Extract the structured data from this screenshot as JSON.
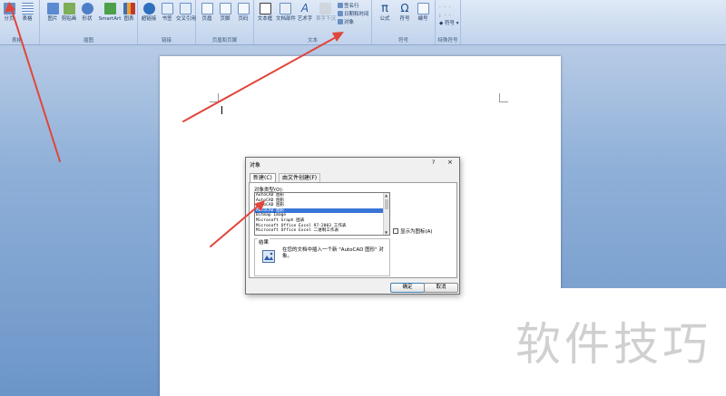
{
  "ribbon": {
    "groups": {
      "table": "表格",
      "illustrations": "插图",
      "links": "链接",
      "header_footer": "页眉和页脚",
      "text": "文本",
      "symbols": "符号",
      "special": "特殊符号"
    },
    "buttons": {
      "page_break": "分页",
      "table": "表格",
      "picture": "图片",
      "clip_art": "剪贴画",
      "shapes": "形状",
      "smartart": "SmartArt",
      "chart": "图表",
      "hyperlink": "超链接",
      "bookmark": "书签",
      "cross_ref": "交叉引用",
      "header": "页眉",
      "footer": "页脚",
      "page_number": "页码",
      "text_box": "文本框",
      "quick_parts": "文档部件",
      "wordart": "艺术字",
      "drop_cap": "首字下沉",
      "signature_line": "签名行",
      "date_time": "日期和时间",
      "object": "对象",
      "equation": "公式",
      "symbol": "符号",
      "numbering": "编号",
      "special_symbol": "符号"
    }
  },
  "dialog": {
    "title": "对象",
    "help": "?",
    "close": "×",
    "tabs": [
      "新建(C)",
      "由文件创建(F)"
    ],
    "object_type_label": "对象类型(O):",
    "object_types": [
      "AutoCAD 图形",
      "AutoCAD 图形",
      "AutoCAD 图形",
      "AutoCAD 图形",
      "Bitmap Image",
      "Microsoft Graph 图表",
      "Microsoft Office Excel 97-2003 工作表",
      "Microsoft Office Excel 二进制工作表"
    ],
    "selected_index": 3,
    "display_as_icon": "显示为图标(A)",
    "result_label": "结果",
    "result_text": "在您的文档中插入一个新 \"AutoCAD 图形\" 对象。",
    "ok": "确定",
    "cancel": "取消"
  },
  "watermark": "软件技巧",
  "colors": {
    "selection": "#3875d7",
    "arrow": "#e2453a",
    "ribbon": "#cddcf0",
    "workspace": "#8fb0d8"
  }
}
